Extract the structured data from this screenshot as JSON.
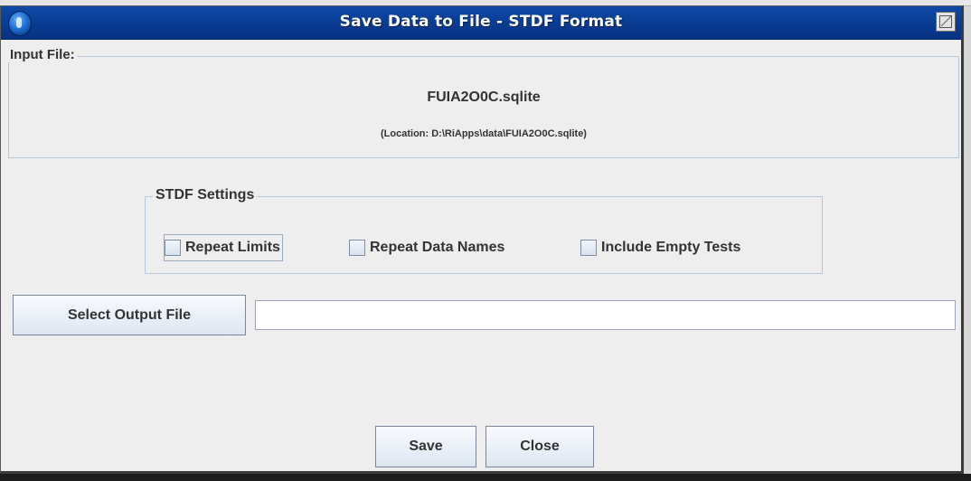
{
  "window": {
    "title": "Save Data to File - STDF Format",
    "title_color": "#0a3c93"
  },
  "input_file": {
    "legend": "Input File:",
    "filename": "FUIA2O0C.sqlite",
    "location": "(Location: D:\\RiApps\\data\\FUIA2O0C.sqlite)"
  },
  "stdf_settings": {
    "legend": "STDF Settings",
    "options": [
      {
        "label": "Repeat Limits",
        "checked": false
      },
      {
        "label": "Repeat Data Names",
        "checked": false
      },
      {
        "label": "Include Empty Tests",
        "checked": false
      }
    ]
  },
  "output": {
    "select_label": "Select Output File",
    "path_value": ""
  },
  "actions": {
    "save_label": "Save",
    "close_label": "Close"
  },
  "icons": {
    "app": "app-globe-icon",
    "maximize": "maximize-icon"
  }
}
